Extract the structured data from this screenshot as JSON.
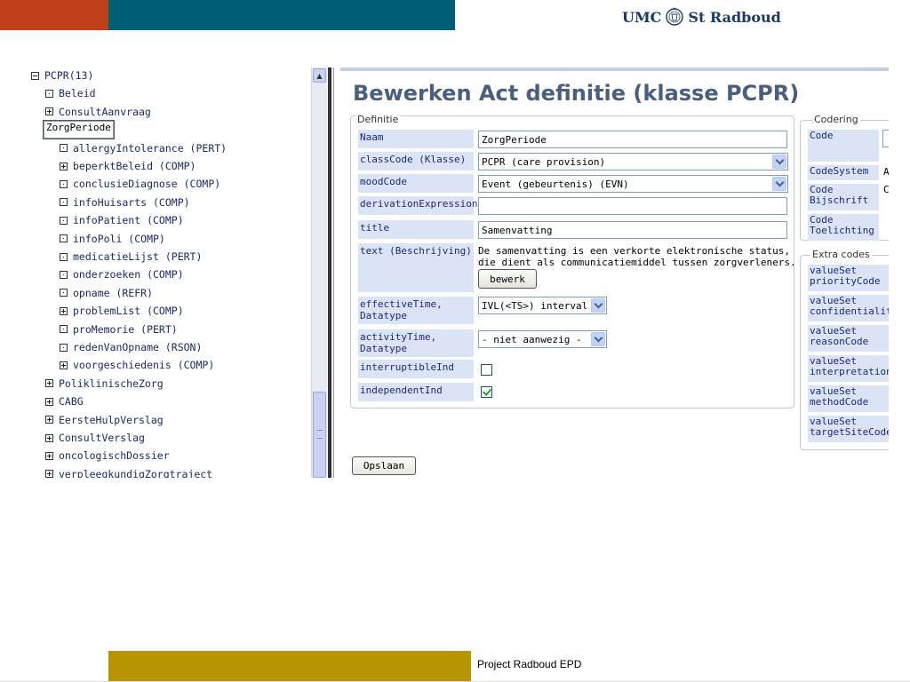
{
  "logo": {
    "left": "UMC",
    "right": "St Radboud"
  },
  "footer": {
    "text": "Project Radboud EPD"
  },
  "tree": [
    {
      "toggle": "minus",
      "label": "PCPR(13)",
      "level": 0
    },
    {
      "toggle": "dot",
      "label": "Beleid",
      "level": 1
    },
    {
      "toggle": "plus",
      "label": "ConsultAanvraag",
      "level": 1
    },
    {
      "toggle": "minus",
      "label": "ZorgPeriode",
      "level": 1,
      "selected": true
    },
    {
      "toggle": "dot",
      "label": "allergyIntolerance (PERT)",
      "level": 2
    },
    {
      "toggle": "plus",
      "label": "beperktBeleid (COMP)",
      "level": 2
    },
    {
      "toggle": "dot",
      "label": "conclusieDiagnose (COMP)",
      "level": 2
    },
    {
      "toggle": "dot",
      "label": "infoHuisarts (COMP)",
      "level": 2
    },
    {
      "toggle": "dot",
      "label": "infoPatient (COMP)",
      "level": 2
    },
    {
      "toggle": "dot",
      "label": "infoPoli (COMP)",
      "level": 2
    },
    {
      "toggle": "dot",
      "label": "medicatieLijst (PERT)",
      "level": 2
    },
    {
      "toggle": "dot",
      "label": "onderzoeken (COMP)",
      "level": 2
    },
    {
      "toggle": "dot",
      "label": "opname (REFR)",
      "level": 2
    },
    {
      "toggle": "plus",
      "label": "problemList (COMP)",
      "level": 2
    },
    {
      "toggle": "dot",
      "label": "proMemorie (PERT)",
      "level": 2
    },
    {
      "toggle": "dot",
      "label": "redenVanOpname (RSON)",
      "level": 2
    },
    {
      "toggle": "plus",
      "label": "voorgeschiedenis (COMP)",
      "level": 2
    },
    {
      "toggle": "plus",
      "label": "PoliklinischeZorg",
      "level": 1
    },
    {
      "toggle": "plus",
      "label": "CABG",
      "level": 1
    },
    {
      "toggle": "plus",
      "label": "EersteHulpVerslag",
      "level": 1
    },
    {
      "toggle": "plus",
      "label": "ConsultVerslag",
      "level": 1
    },
    {
      "toggle": "plus",
      "label": "oncologischDossier",
      "level": 1
    },
    {
      "toggle": "plus",
      "label": "verpleegkundigZorgtraject",
      "level": 1
    }
  ],
  "form": {
    "title": "Bewerken Act definitie (klasse PCPR)",
    "definitie_legend": "Definitie",
    "naam": {
      "label": "Naam",
      "value": "ZorgPeriode"
    },
    "classCode": {
      "label": "classCode (Klasse)",
      "value": "PCPR (care provision)"
    },
    "moodCode": {
      "label": "moodCode",
      "value": "Event (gebeurtenis) (EVN)"
    },
    "derivationExpression": {
      "label": "derivationExpression",
      "value": ""
    },
    "title_field": {
      "label": "title",
      "value": "Samenvatting"
    },
    "text": {
      "label": "text (Beschrijving)",
      "line1": "De samenvatting is een verkorte elektronische status,",
      "line2": "die dient als communicatiemiddel tussen zorgverleners.",
      "button": "bewerk"
    },
    "effectiveTime": {
      "label_line1": "effectiveTime,",
      "label_line2": "Datatype",
      "value": "IVL(<TS>) interval"
    },
    "activityTime": {
      "label_line1": "activityTime,",
      "label_line2": "Datatype",
      "value": "- niet aanwezig -"
    },
    "interruptibleInd": {
      "label": "interruptibleInd",
      "checked": false
    },
    "independentInd": {
      "label": "independentInd",
      "checked": true
    },
    "save_button": "Opslaan"
  },
  "codering": {
    "legend": "Codering",
    "code_label": "Code",
    "codesystem_label": "CodeSystem",
    "codesystem_value": "A",
    "bijschrift_line1": "Code",
    "bijschrift_line2": "Bijschrift",
    "bijschrift_value": "C",
    "toelichting_line1": "Code",
    "toelichting_line2": "Toelichting"
  },
  "extra_codes": {
    "legend": "Extra codes",
    "items": [
      {
        "line1": "valueSet",
        "line2": "priorityCode"
      },
      {
        "line1": "valueSet",
        "line2": "confidentialityC"
      },
      {
        "line1": "valueSet",
        "line2": "reasonCode"
      },
      {
        "line1": "valueSet",
        "line2": "interpretationC"
      },
      {
        "line1": "valueSet",
        "line2": "methodCode"
      },
      {
        "line1": "valueSet",
        "line2": "targetSiteCode"
      }
    ]
  }
}
